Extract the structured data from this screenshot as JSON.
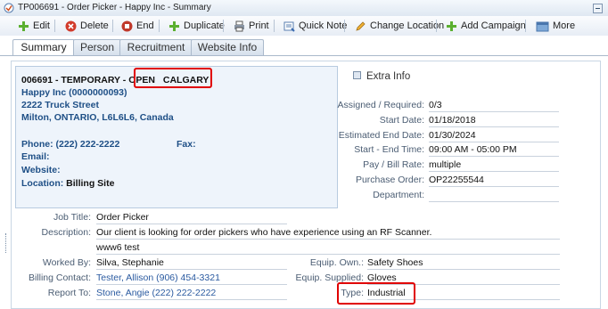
{
  "window": {
    "title": "TP006691 - Order Picker - Happy Inc - Summary"
  },
  "toolbar": {
    "edit": "Edit",
    "delete": "Delete",
    "end": "End",
    "duplicate": "Duplicate",
    "print": "Print",
    "quick_note": "Quick Note",
    "change_location": "Change Location",
    "add_campaign": "Add Campaign",
    "more": "More"
  },
  "tabs": [
    "Summary",
    "Person",
    "Recruitment",
    "Website Info"
  ],
  "summary": {
    "heading": "006691 - TEMPORARY - OPEN",
    "city": "CALGARY",
    "company": "Happy Inc (0000000093)",
    "street": "2222 Truck Street",
    "citystate": "Milton, ONTARIO, L6L6L6, Canada",
    "phone": "Phone: (222) 222-2222",
    "fax": "Fax:",
    "email": "Email:",
    "website": "Website:",
    "location_label": "Location:",
    "location_value": "Billing Site"
  },
  "extra_info": {
    "title": "Extra Info",
    "rows": [
      {
        "label": "Assigned / Required:",
        "value": "0/3"
      },
      {
        "label": "Start Date:",
        "value": "01/18/2018"
      },
      {
        "label": "Estimated End Date:",
        "value": "01/30/2024"
      },
      {
        "label": "Start - End Time:",
        "value": "09:00 AM - 05:00 PM"
      },
      {
        "label": "Pay / Bill Rate:",
        "value": "multiple"
      },
      {
        "label": "Purchase Order:",
        "value": "OP22255544"
      },
      {
        "label": "Department:",
        "value": ""
      }
    ]
  },
  "details": {
    "job_title_label": "Job Title:",
    "job_title": "Order Picker",
    "description_label": "Description:",
    "description": "Our client is looking for order pickers who have experience using an RF Scanner.",
    "description_extra": "www6 test",
    "worked_by_label": "Worked By:",
    "worked_by": "Silva, Stephanie",
    "billing_contact_label": "Billing Contact:",
    "billing_contact": "Tester, Allison (906) 454-3321",
    "report_to_label": "Report To:",
    "report_to": "Stone, Angie (222) 222-2222",
    "equip_own_label": "Equip. Own.:",
    "equip_own": "Safety Shoes",
    "equip_supplied_label": "Equip. Supplied:",
    "equip_supplied": "Gloves",
    "type_label": "Type:",
    "type": "Industrial"
  },
  "colors": {
    "highlight": "#e00000",
    "link": "#2a5aa0",
    "info_bg": "#eef4fb"
  }
}
